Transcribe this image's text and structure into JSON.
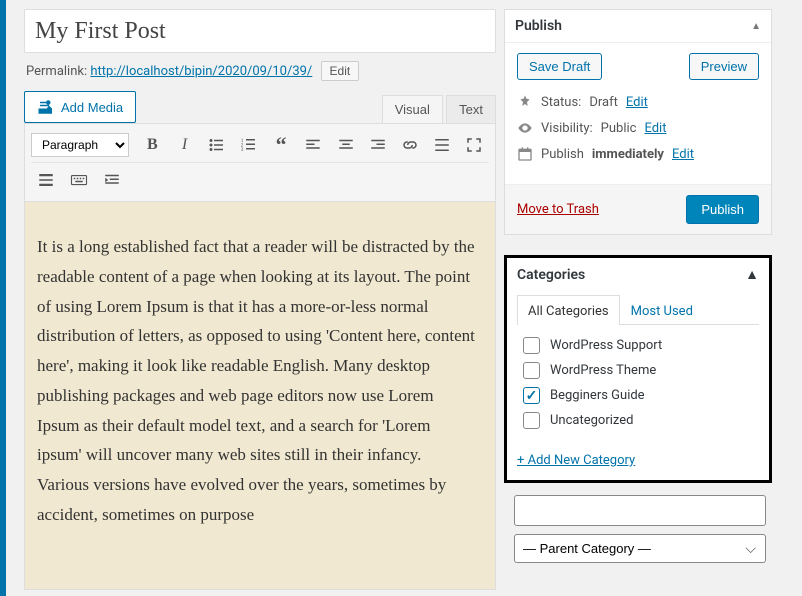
{
  "title": "My First Post",
  "permalink_label": "Permalink:",
  "permalink_url": "http://localhost/bipin/2020/09/10/39/",
  "permalink_edit": "Edit",
  "add_media_label": "Add Media",
  "editor_tabs": {
    "visual": "Visual",
    "text": "Text"
  },
  "format_select": "Paragraph",
  "content_body": "It is a long established fact that a reader will be distracted by the readable content of a page when looking at its layout. The point of using Lorem Ipsum is that it has a more-or-less normal distribution of letters, as opposed to using 'Content here, content here', making it look like readable English. Many desktop publishing packages and web page editors now use Lorem Ipsum as their default model text, and a search for 'Lorem ipsum' will uncover many web sites still in their infancy. Various versions have evolved over the years, sometimes by accident, sometimes on purpose",
  "publish": {
    "title": "Publish",
    "save_draft": "Save Draft",
    "preview": "Preview",
    "status_label": "Status:",
    "status_value": "Draft",
    "visibility_label": "Visibility:",
    "visibility_value": "Public",
    "schedule_label": "Publish",
    "schedule_value": "immediately",
    "edit_link": "Edit",
    "trash": "Move to Trash",
    "publish_btn": "Publish"
  },
  "categories": {
    "title": "Categories",
    "tabs": {
      "all": "All Categories",
      "most_used": "Most Used"
    },
    "items": [
      {
        "label": "WordPress Support",
        "checked": false
      },
      {
        "label": "WordPress Theme",
        "checked": false
      },
      {
        "label": "Begginers Guide",
        "checked": true
      },
      {
        "label": "Uncategorized",
        "checked": false
      }
    ],
    "add_new": "+ Add New Category",
    "new_cat_placeholder": "",
    "parent_placeholder": "— Parent Category —"
  }
}
